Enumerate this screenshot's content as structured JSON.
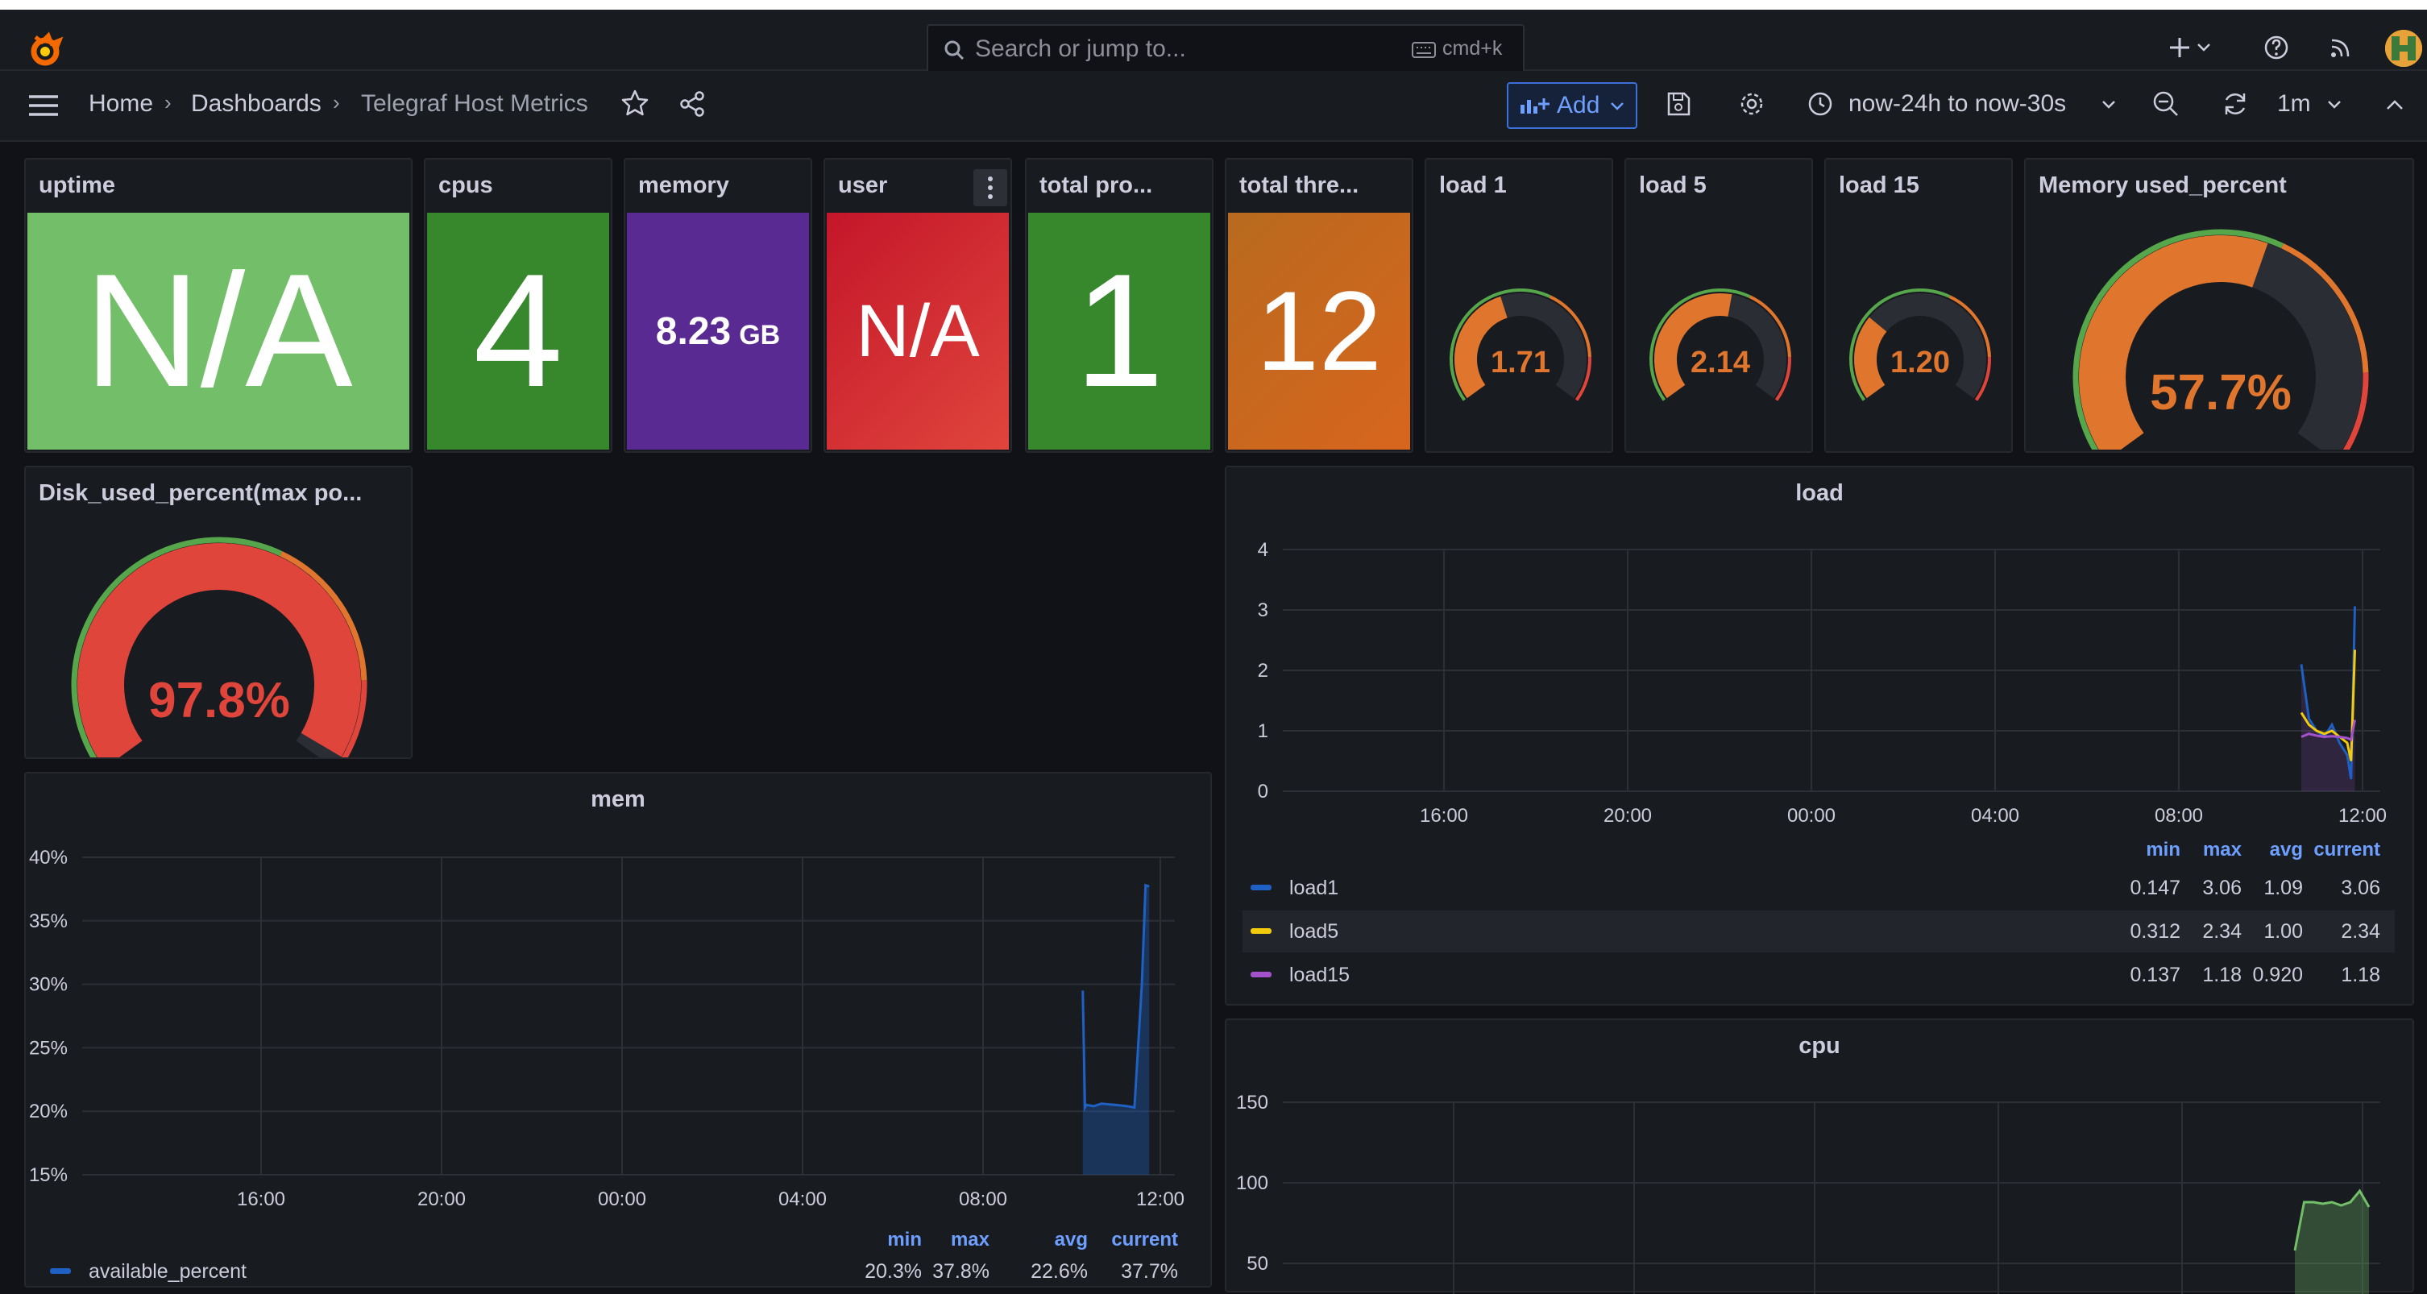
{
  "topbar": {
    "search_placeholder": "Search or jump to...",
    "search_shortcut": "cmd+k"
  },
  "breadcrumb": {
    "home": "Home",
    "dashboards": "Dashboards",
    "current": "Telegraf Host Metrics"
  },
  "toolbar": {
    "add_label": "Add",
    "time_range": "now-24h to now-30s",
    "refresh_interval": "1m"
  },
  "stats": {
    "uptime": {
      "title": "uptime",
      "value": "N/A",
      "color": "#73bf69"
    },
    "cpus": {
      "title": "cpus",
      "value": "4",
      "color": "#37872d"
    },
    "memory": {
      "title": "memory",
      "value": "8.23",
      "unit": "GB",
      "color": "#5a2a93"
    },
    "user": {
      "title": "user",
      "value": "N/A",
      "color": "#c4162a"
    },
    "total_processes": {
      "title": "total pro...",
      "value": "1",
      "color": "#37872d"
    },
    "total_threads": {
      "title": "total thre...",
      "value": "12",
      "color": "#d8651e"
    }
  },
  "gauges": {
    "load1": {
      "title": "load 1",
      "value": "1.71",
      "fraction": 0.43,
      "color": "#e0752d"
    },
    "load5": {
      "title": "load 5",
      "value": "2.14",
      "fraction": 0.54,
      "color": "#e0752d"
    },
    "load15": {
      "title": "load 15",
      "value": "1.20",
      "fraction": 0.3,
      "color": "#e0752d"
    },
    "memory_used_percent": {
      "title": "Memory used_percent",
      "value": "57.7%",
      "fraction": 0.577,
      "color": "#e0752d"
    },
    "disk_used_percent": {
      "title": "Disk_used_percent(max po...",
      "value": "97.8%",
      "fraction": 0.978,
      "color": "#e0453c"
    }
  },
  "load_panel": {
    "title": "load",
    "legend_headers": [
      "min",
      "max",
      "avg",
      "current"
    ],
    "legend_rows": [
      {
        "name": "load1",
        "color": "#1f60c4",
        "min": "0.147",
        "max": "3.06",
        "avg": "1.09",
        "current": "3.06"
      },
      {
        "name": "load5",
        "color": "#f2cc0c",
        "min": "0.312",
        "max": "2.34",
        "avg": "1.00",
        "current": "2.34"
      },
      {
        "name": "load15",
        "color": "#a352cc",
        "min": "0.137",
        "max": "1.18",
        "avg": "0.920",
        "current": "1.18"
      }
    ]
  },
  "mem_panel": {
    "title": "mem",
    "legend_headers": [
      "min",
      "max",
      "avg",
      "current"
    ],
    "legend_rows": [
      {
        "name": "available_percent",
        "color": "#1f60c4",
        "min": "20.3%",
        "max": "37.8%",
        "avg": "22.6%",
        "current": "37.7%"
      }
    ]
  },
  "cpu_panel": {
    "title": "cpu"
  },
  "chart_data": [
    {
      "type": "line",
      "title": "load",
      "x_ticks": [
        "16:00",
        "20:00",
        "00:00",
        "04:00",
        "08:00",
        "12:00"
      ],
      "y_ticks": [
        "0",
        "1",
        "2",
        "3",
        "4"
      ],
      "ylim": [
        0,
        4
      ],
      "series": [
        {
          "name": "load1",
          "x": [
            "10:40",
            "10:50",
            "11:00",
            "11:10",
            "11:20",
            "11:30",
            "11:40",
            "11:45",
            "11:50"
          ],
          "values": [
            2.1,
            1.2,
            1.0,
            0.9,
            1.1,
            0.8,
            0.6,
            0.2,
            3.06
          ]
        },
        {
          "name": "load5",
          "x": [
            "10:40",
            "10:50",
            "11:00",
            "11:10",
            "11:20",
            "11:30",
            "11:40",
            "11:45",
            "11:50"
          ],
          "values": [
            1.3,
            1.1,
            1.0,
            0.95,
            1.0,
            0.9,
            0.8,
            0.5,
            2.34
          ]
        },
        {
          "name": "load15",
          "x": [
            "10:40",
            "10:50",
            "11:00",
            "11:10",
            "11:20",
            "11:30",
            "11:40",
            "11:45",
            "11:50"
          ],
          "values": [
            0.9,
            0.95,
            0.92,
            0.9,
            0.91,
            0.9,
            0.88,
            0.85,
            1.18
          ]
        }
      ]
    },
    {
      "type": "area",
      "title": "mem",
      "x_ticks": [
        "16:00",
        "20:00",
        "00:00",
        "04:00",
        "08:00",
        "12:00"
      ],
      "y_ticks": [
        "15%",
        "20%",
        "25%",
        "30%",
        "35%",
        "40%"
      ],
      "ylim": [
        15,
        40
      ],
      "series": [
        {
          "name": "available_percent",
          "x": [
            "10:15",
            "10:18",
            "10:20",
            "10:30",
            "10:40",
            "11:00",
            "11:15",
            "11:25",
            "11:35",
            "11:40",
            "11:45"
          ],
          "values": [
            29.5,
            20.3,
            20.5,
            20.4,
            20.6,
            20.5,
            20.4,
            20.3,
            30.0,
            37.8,
            37.7
          ]
        }
      ]
    },
    {
      "type": "area",
      "title": "cpu",
      "y_ticks": [
        "50",
        "100",
        "150"
      ],
      "ylim": [
        40,
        160
      ],
      "series": [
        {
          "values": [
            58,
            88,
            88,
            87,
            88,
            86,
            88,
            95,
            85
          ]
        }
      ]
    }
  ]
}
